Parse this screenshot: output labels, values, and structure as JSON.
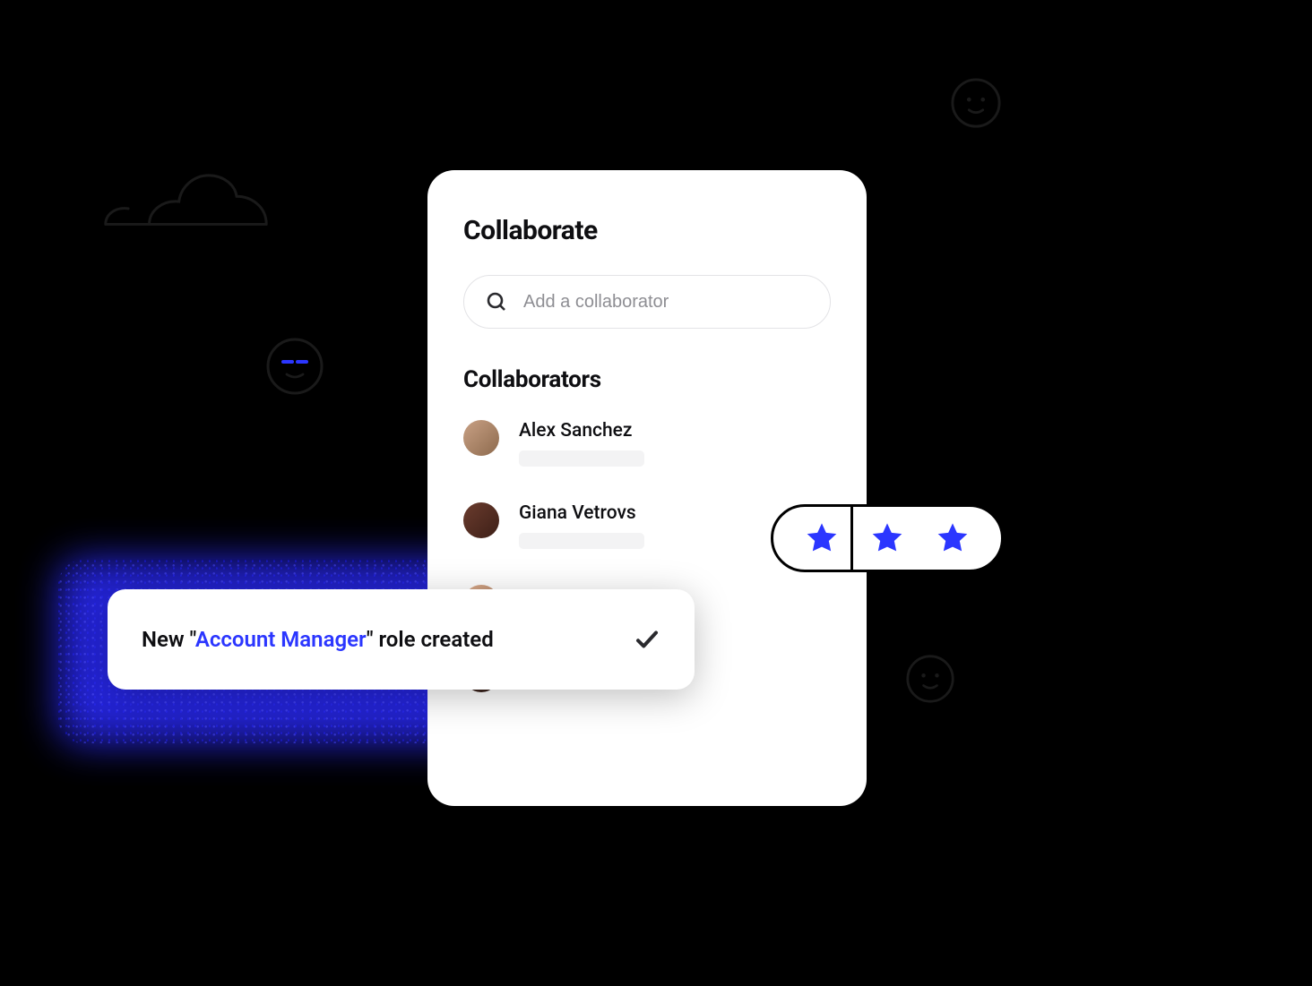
{
  "card": {
    "title": "Collaborate",
    "search_placeholder": "Add a collaborator",
    "section_title": "Collaborators",
    "collaborators": [
      {
        "name": "Alex Sanchez"
      },
      {
        "name": "Giana Vetrovs"
      },
      {
        "name": ""
      },
      {
        "name": ""
      }
    ]
  },
  "toast": {
    "prefix": "New \"",
    "accent": "Account Manager",
    "suffix": "\" role created"
  },
  "stars": {
    "count": 3
  },
  "icons": {
    "search": "search-icon",
    "check": "check-icon",
    "star": "star-icon",
    "cloud": "cloud-icon",
    "smiley": "smiley-icon"
  },
  "colors": {
    "accent": "#2b36ff"
  }
}
